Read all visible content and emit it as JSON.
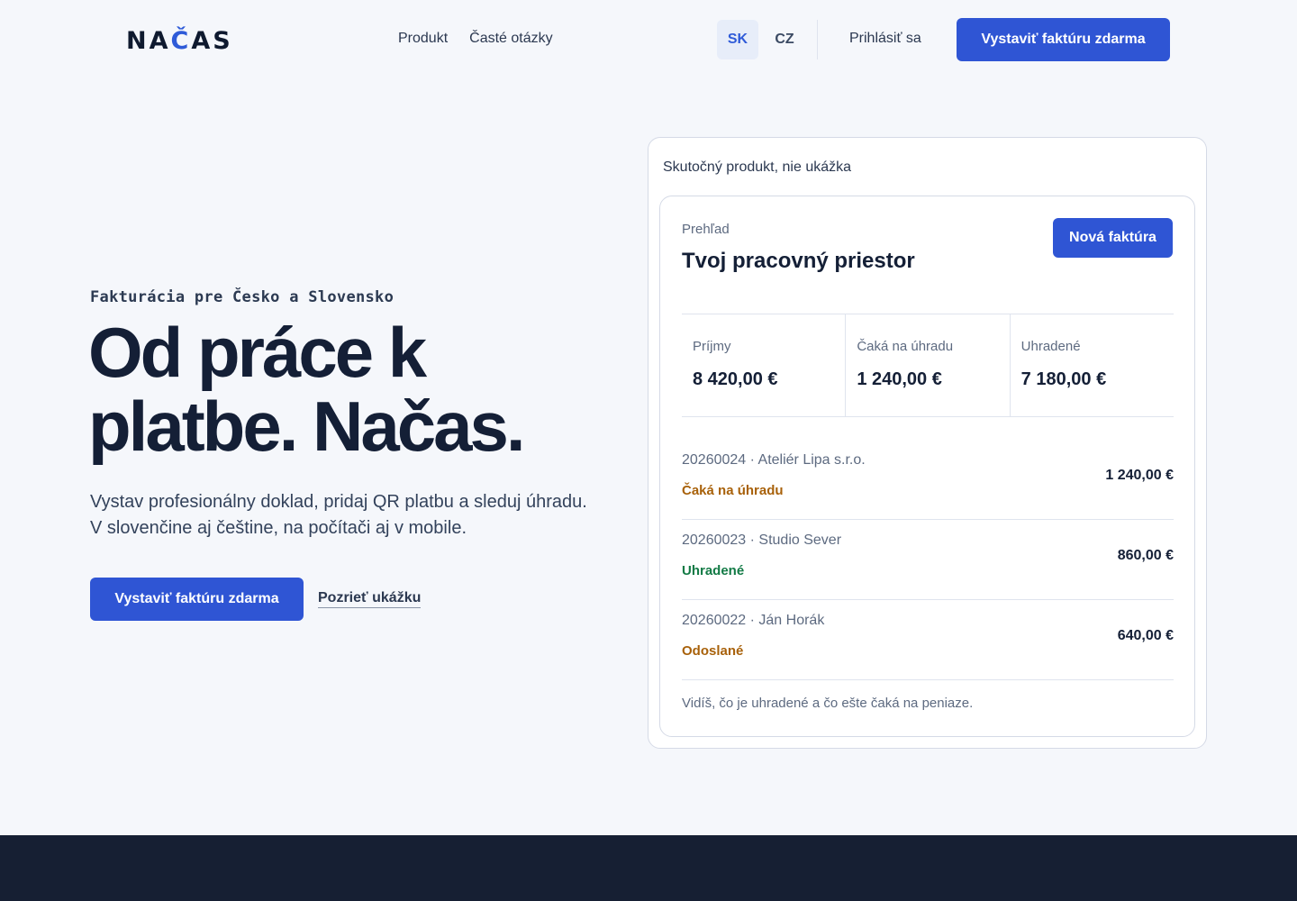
{
  "header": {
    "logo_pre": "NA",
    "logo_accent": "Č",
    "logo_post": "AS",
    "nav": [
      "Produkt",
      "Časté otázky"
    ],
    "languages": [
      "SK",
      "CZ"
    ],
    "active_language": "SK",
    "login_label": "Prihlásiť sa",
    "cta_label": "Vystaviť faktúru zdarma"
  },
  "hero": {
    "eyebrow": "Fakturácia pre Česko a Slovensko",
    "title_line1": "Od práce k",
    "title_line2": "platbe. Načas.",
    "subtitle_line1": "Vystav profesionálny doklad, pridaj QR platbu a sleduj úhradu.",
    "subtitle_line2": "V slovenčine aj češtine, na počítači aj v mobile.",
    "cta_label": "Vystaviť faktúru zdarma",
    "demo_link": "Pozrieť ukážku"
  },
  "panel": {
    "caption": "Skutočný produkt, nie ukážka",
    "kicker": "Prehľad",
    "title": "Tvoj pracovný priestor",
    "new_invoice_label": "Nová faktúra",
    "stats": [
      {
        "label": "Príjmy",
        "value": "8 420,00 €"
      },
      {
        "label": "Čaká na úhradu",
        "value": "1 240,00 €"
      },
      {
        "label": "Uhradené",
        "value": "7 180,00 €"
      }
    ],
    "invoices": [
      {
        "meta": "20260024 · Ateliér Lipa s.r.o.",
        "status": "Čaká na úhradu",
        "amount": "1 240,00 €",
        "status_color": "#a8610a"
      },
      {
        "meta": "20260023 · Studio Sever",
        "status": "Uhradené",
        "amount": "860,00 €",
        "status_color": "#127a45"
      },
      {
        "meta": "20260022 · Ján Horák",
        "status": "Odoslané",
        "amount": "640,00 €",
        "status_color": "#a8610a"
      }
    ],
    "footnote": "Vidíš, čo je uhradené a čo ešte čaká na peniaze."
  },
  "colors": {
    "primary": "#2f55d4",
    "background": "#f5f7fb",
    "dark_band": "#161f33"
  }
}
